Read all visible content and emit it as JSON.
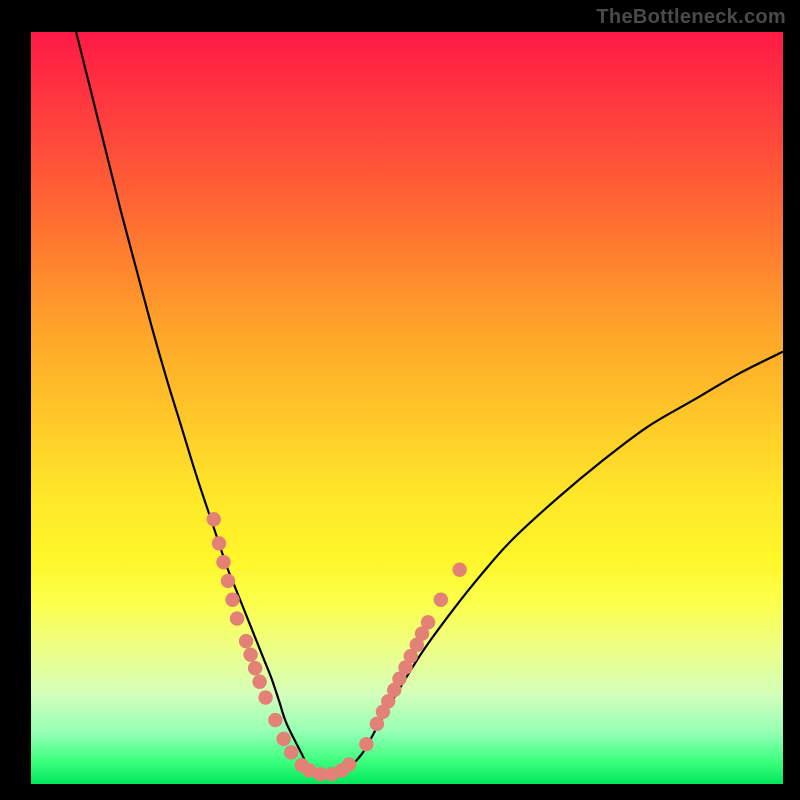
{
  "watermark": "TheBottleneck.com",
  "colors": {
    "background": "#000000",
    "curve_stroke": "#000000",
    "marker_fill": "#e38176",
    "marker_stroke": "#d86e63"
  },
  "chart_data": {
    "type": "line",
    "title": "",
    "xlabel": "",
    "ylabel": "",
    "xlim": [
      0,
      100
    ],
    "ylim": [
      0,
      100
    ],
    "grid": false,
    "legend": false,
    "series": [
      {
        "name": "bottleneck-curve",
        "x": [
          6,
          8,
          10,
          12,
          14,
          16,
          18,
          20,
          22,
          24,
          25,
          26,
          27,
          28,
          29,
          30,
          31,
          32,
          33,
          34,
          36,
          37,
          38.5,
          40,
          42,
          44,
          46,
          48,
          52,
          56,
          60,
          64,
          70,
          76,
          82,
          88,
          94,
          100
        ],
        "y": [
          100,
          92,
          84,
          76,
          68.5,
          61,
          54,
          47.5,
          41,
          35,
          32,
          29,
          26.5,
          24,
          21.5,
          19,
          16.5,
          14,
          11,
          8,
          4,
          2,
          1,
          1,
          2,
          4,
          7.5,
          11,
          17.5,
          23,
          28,
          32.5,
          38,
          43,
          47.5,
          51,
          54.5,
          57.5
        ]
      }
    ],
    "markers": [
      {
        "x": 24.3,
        "y": 35.2
      },
      {
        "x": 25.0,
        "y": 32.0
      },
      {
        "x": 25.6,
        "y": 29.5
      },
      {
        "x": 26.2,
        "y": 27.0
      },
      {
        "x": 26.8,
        "y": 24.5
      },
      {
        "x": 27.4,
        "y": 22.0
      },
      {
        "x": 28.6,
        "y": 19.0
      },
      {
        "x": 29.2,
        "y": 17.2
      },
      {
        "x": 29.8,
        "y": 15.4
      },
      {
        "x": 30.4,
        "y": 13.6
      },
      {
        "x": 31.2,
        "y": 11.5
      },
      {
        "x": 32.5,
        "y": 8.5
      },
      {
        "x": 33.6,
        "y": 6.0
      },
      {
        "x": 34.6,
        "y": 4.2
      },
      {
        "x": 36.0,
        "y": 2.5
      },
      {
        "x": 37.0,
        "y": 1.8
      },
      {
        "x": 38.5,
        "y": 1.3
      },
      {
        "x": 40.0,
        "y": 1.3
      },
      {
        "x": 41.3,
        "y": 1.8
      },
      {
        "x": 42.3,
        "y": 2.6
      },
      {
        "x": 44.6,
        "y": 5.3
      },
      {
        "x": 46.0,
        "y": 8.0
      },
      {
        "x": 46.8,
        "y": 9.6
      },
      {
        "x": 47.5,
        "y": 11.0
      },
      {
        "x": 48.3,
        "y": 12.5
      },
      {
        "x": 49.0,
        "y": 14.0
      },
      {
        "x": 49.8,
        "y": 15.5
      },
      {
        "x": 50.5,
        "y": 17.0
      },
      {
        "x": 51.3,
        "y": 18.5
      },
      {
        "x": 52.0,
        "y": 20.0
      },
      {
        "x": 52.8,
        "y": 21.5
      },
      {
        "x": 54.5,
        "y": 24.5
      },
      {
        "x": 57.0,
        "y": 28.5
      }
    ]
  }
}
